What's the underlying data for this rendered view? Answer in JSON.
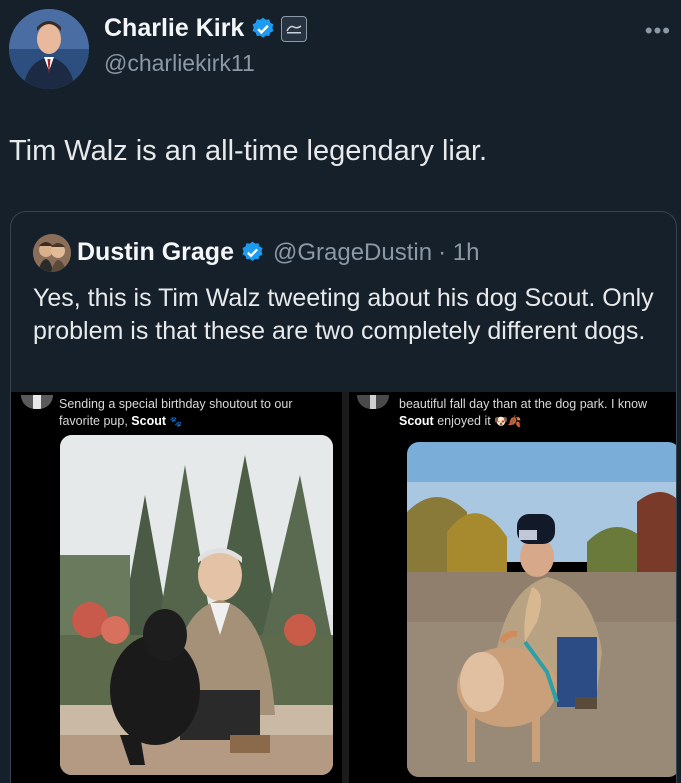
{
  "author": {
    "name": "Charlie Kirk",
    "handle": "@charliekirk11"
  },
  "tweet": {
    "text": "Tim Walz is an all-time legendary liar."
  },
  "more_label": "•••",
  "quote": {
    "name": "Dustin Grage",
    "handle": "@GrageDustin",
    "time": "· 1h",
    "text": "Yes, this is Tim Walz tweeting about his dog Scout. Only problem is that these are two completely different dogs."
  },
  "left_post": {
    "text": "Sending a special birthday shoutout to our favorite pup,",
    "bold": "Scout"
  },
  "right_post": {
    "line1": "beautiful fall day than at the dog park. I know",
    "bold": "Scout",
    "rest": "enjoyed it"
  },
  "icons": {
    "verified": "verified-badge-icon",
    "org": "organization-badge-icon",
    "more": "more-options-icon"
  },
  "colors": {
    "background": "#15202b",
    "verified": "#1d9bf0",
    "handle": "#8b98a5"
  }
}
